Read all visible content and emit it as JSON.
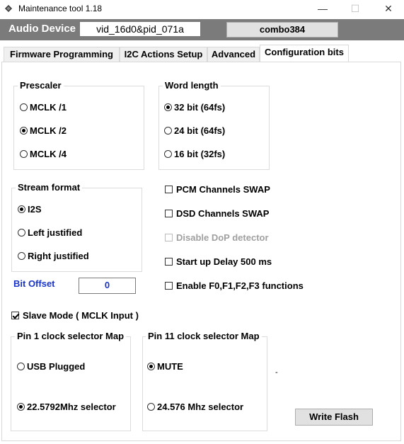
{
  "window": {
    "title": "Maintenance tool 1.18",
    "minimize_glyph": "—",
    "maximize_glyph": "☐",
    "close_glyph": "✕"
  },
  "device": {
    "label": "Audio Device",
    "id_value": "vid_16d0&pid_071a",
    "model_button": "combo384"
  },
  "tabs": [
    {
      "label": "Firmware Programming",
      "active": false
    },
    {
      "label": "I2C Actions Setup",
      "active": false
    },
    {
      "label": "Advanced",
      "active": false
    },
    {
      "label": "Configuration bits",
      "active": true
    }
  ],
  "prescaler": {
    "title": "Prescaler",
    "options": [
      {
        "label": "MCLK /1",
        "selected": false
      },
      {
        "label": "MCLK /2",
        "selected": true
      },
      {
        "label": "MCLK /4",
        "selected": false
      }
    ]
  },
  "word_length": {
    "title": "Word length",
    "options": [
      {
        "label": "32 bit (64fs)",
        "selected": true
      },
      {
        "label": "24 bit (64fs)",
        "selected": false
      },
      {
        "label": "16 bit (32fs)",
        "selected": false
      }
    ]
  },
  "stream_format": {
    "title": "Stream format",
    "options": [
      {
        "label": "I2S",
        "selected": true
      },
      {
        "label": "Left justified",
        "selected": false
      },
      {
        "label": "Right justified",
        "selected": false
      }
    ]
  },
  "checkboxes": [
    {
      "label": "PCM Channels SWAP",
      "checked": false,
      "enabled": true
    },
    {
      "label": "DSD Channels SWAP",
      "checked": false,
      "enabled": true
    },
    {
      "label": "Disable DoP detector",
      "checked": false,
      "enabled": false
    },
    {
      "label": "Start up Delay 500 ms",
      "checked": false,
      "enabled": true
    },
    {
      "label": "Enable F0,F1,F2,F3 functions",
      "checked": false,
      "enabled": true
    }
  ],
  "bit_offset": {
    "label": "Bit Offset",
    "value": "0"
  },
  "slave_mode": {
    "label": "Slave Mode ( MCLK Input )",
    "checked": true
  },
  "pin1_map": {
    "title": "Pin 1 clock selector Map",
    "options": [
      {
        "label": "USB Plugged",
        "selected": false
      },
      {
        "label": "22.5792Mhz selector",
        "selected": true
      }
    ]
  },
  "pin11_map": {
    "title": "Pin 11 clock selector Map",
    "options": [
      {
        "label": "MUTE",
        "selected": true
      },
      {
        "label": "24.576 Mhz selector",
        "selected": false
      }
    ]
  },
  "stray_mark": "-",
  "write_flash_label": "Write Flash"
}
